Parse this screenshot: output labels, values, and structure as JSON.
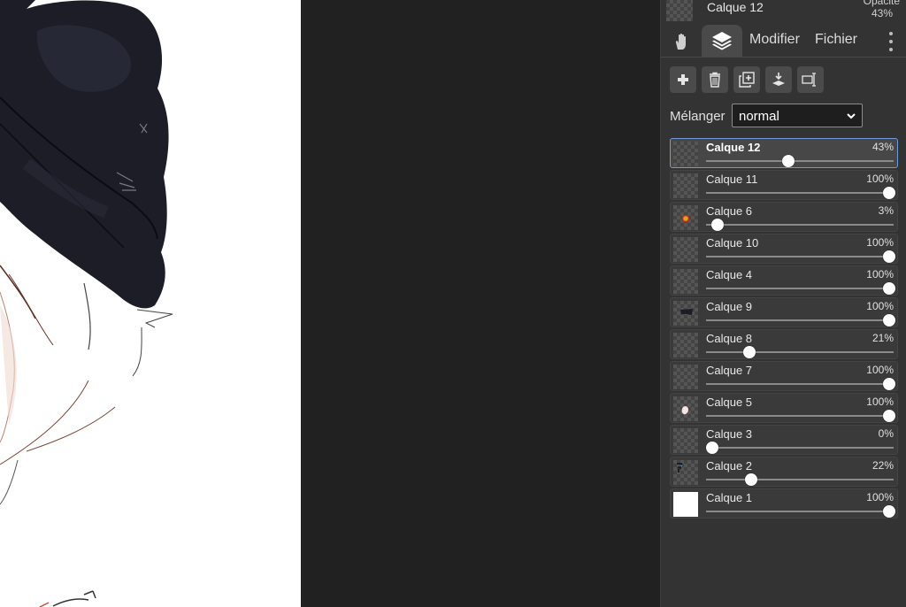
{
  "header": {
    "current_layer": "Calque 12",
    "opacity_label": "Opacité",
    "opacity_value": "43%"
  },
  "tabs": {
    "modify": "Modifier",
    "file": "Fichier"
  },
  "blend": {
    "label": "Mélanger",
    "value": "normal"
  },
  "toolbar": [
    {
      "name": "add-layer-button",
      "icon": "plus-icon"
    },
    {
      "name": "delete-layer-button",
      "icon": "trash-icon"
    },
    {
      "name": "duplicate-layer-button",
      "icon": "duplicate-icon"
    },
    {
      "name": "merge-down-button",
      "icon": "merge-down-icon"
    },
    {
      "name": "rename-layer-button",
      "icon": "rename-icon"
    }
  ],
  "layers": [
    {
      "name": "Calque 12",
      "opacity": "43%",
      "level": 0.43,
      "selected": true,
      "thumb": "checker"
    },
    {
      "name": "Calque 11",
      "opacity": "100%",
      "level": 1.0,
      "selected": false,
      "thumb": "checker"
    },
    {
      "name": "Calque 6",
      "opacity": "3%",
      "level": 0.03,
      "selected": false,
      "thumb": "orange-dot"
    },
    {
      "name": "Calque 10",
      "opacity": "100%",
      "level": 1.0,
      "selected": false,
      "thumb": "checker"
    },
    {
      "name": "Calque 4",
      "opacity": "100%",
      "level": 1.0,
      "selected": false,
      "thumb": "checker"
    },
    {
      "name": "Calque 9",
      "opacity": "100%",
      "level": 1.0,
      "selected": false,
      "thumb": "dark-shape"
    },
    {
      "name": "Calque 8",
      "opacity": "21%",
      "level": 0.21,
      "selected": false,
      "thumb": "checker"
    },
    {
      "name": "Calque 7",
      "opacity": "100%",
      "level": 1.0,
      "selected": false,
      "thumb": "checker"
    },
    {
      "name": "Calque 5",
      "opacity": "100%",
      "level": 1.0,
      "selected": false,
      "thumb": "face"
    },
    {
      "name": "Calque 3",
      "opacity": "0%",
      "level": 0.0,
      "selected": false,
      "thumb": "checker"
    },
    {
      "name": "Calque 2",
      "opacity": "22%",
      "level": 0.22,
      "selected": false,
      "thumb": "sketch"
    },
    {
      "name": "Calque 1",
      "opacity": "100%",
      "level": 1.0,
      "selected": false,
      "thumb": "white"
    }
  ],
  "colors": {
    "panel": "#333333",
    "workspace": "#212121",
    "selection": "#6f9bd8",
    "hat": "#1c1d26"
  }
}
